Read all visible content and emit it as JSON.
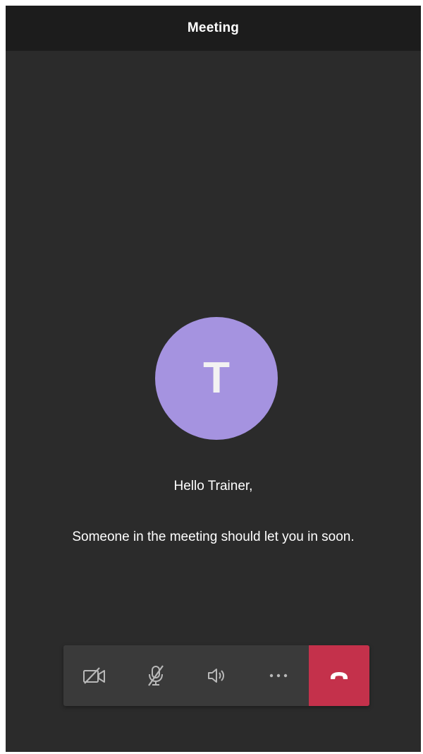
{
  "header": {
    "title": "Meeting"
  },
  "avatar": {
    "initial": "T",
    "color": "#a593e0"
  },
  "message": {
    "greeting": "Hello Trainer,",
    "status": "Someone in the meeting should let you in soon."
  },
  "controls": [
    {
      "icon": "camera-off-icon",
      "state": "off"
    },
    {
      "icon": "microphone-muted-icon",
      "state": "muted"
    },
    {
      "icon": "speaker-icon",
      "state": "on"
    },
    {
      "icon": "more-options-icon"
    },
    {
      "icon": "hang-up-icon",
      "color": "#c4314b"
    }
  ],
  "colors": {
    "background": "#2b2b2b",
    "header": "#1c1c1c",
    "control_bar": "#3a3a3a",
    "icon": "#b8b8b8",
    "hangup": "#c4314b"
  }
}
